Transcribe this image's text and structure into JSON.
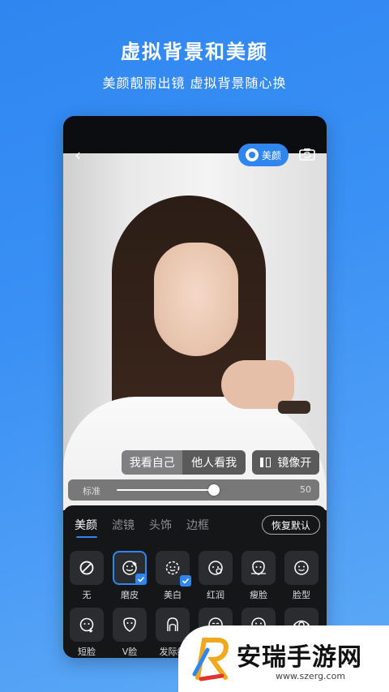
{
  "hero": {
    "title": "虚拟背景和美颜",
    "subtitle": "美颜靓丽出镜 虚拟背景随心换"
  },
  "top_bar": {
    "beauty_label": "美颜"
  },
  "view_toggle": {
    "self_view": "我看自己",
    "others_view": "他人看我",
    "mirror_label": "镜像开"
  },
  "slider": {
    "label": "标准",
    "value": "50",
    "fraction": 0.56
  },
  "panel": {
    "tabs": [
      "美颜",
      "滤镜",
      "头饰",
      "边框"
    ],
    "active_tab": 0,
    "reset_label": "恢复默认",
    "row1": [
      "无",
      "磨皮",
      "美白",
      "红润",
      "瘦脸",
      "脸型"
    ],
    "row2": [
      "短脸",
      "V脸",
      "发际线",
      "",
      "",
      ""
    ]
  },
  "watermark": {
    "brand": "安瑞手游网",
    "url": "www.szerg.com"
  },
  "colors": {
    "accent": "#2f86f0",
    "panel_bg": "#151618"
  }
}
